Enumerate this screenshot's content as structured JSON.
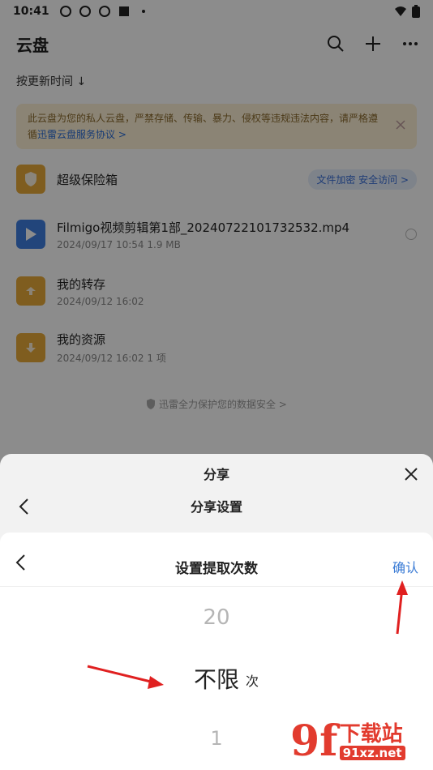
{
  "statusbar": {
    "time": "10:41"
  },
  "appbar": {
    "title": "云盘"
  },
  "sortbar": {
    "label": "按更新时间 ↓"
  },
  "notice": {
    "text": "此云盘为您的私人云盘，严禁存储、传输、暴力、侵权等违规违法内容，请严格遵循",
    "link": "迅雷云盘服务协议 >"
  },
  "files": [
    {
      "name": "超级保险箱",
      "meta": "",
      "tag": "文件加密 安全访问 >",
      "icon": "vault-icon"
    },
    {
      "name": "Filmigo视频剪辑第1部_20240722101732532.mp4",
      "meta": "2024/09/17 10:54  1.9 MB",
      "icon": "video-icon"
    },
    {
      "name": "我的转存",
      "meta": "2024/09/12 16:02",
      "icon": "folder-icon"
    },
    {
      "name": "我的资源",
      "meta": "2024/09/12 16:02  1 项",
      "icon": "folder-download-icon"
    }
  ],
  "security": {
    "label": "迅雷全力保护您的数据安全 >"
  },
  "share": {
    "title": "分享",
    "settings": "分享设置"
  },
  "picker": {
    "title": "设置提取次数",
    "confirm": "确认",
    "prev": "20",
    "current": "不限",
    "unit": "次",
    "next": "1"
  },
  "watermark": {
    "logo": "9f",
    "title": "下载站",
    "url": "91xz.net"
  },
  "colors": {
    "accent": "#3a7bd5",
    "annotation": "#e02020"
  }
}
